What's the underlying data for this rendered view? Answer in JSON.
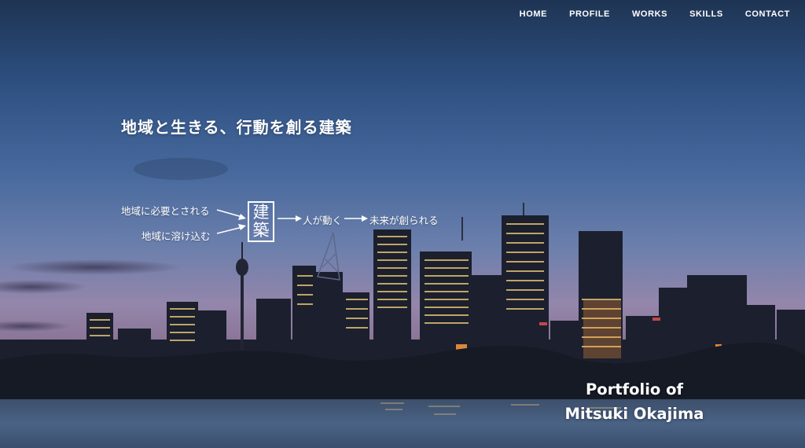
{
  "nav": {
    "items": [
      {
        "label": "HOME"
      },
      {
        "label": "PROFILE"
      },
      {
        "label": "WORKS"
      },
      {
        "label": "SKILLS"
      },
      {
        "label": "CONTACT"
      }
    ]
  },
  "hero": {
    "headline": "地域と生きる、行動を創る建築",
    "concept": {
      "input_top": "地域に必要とされる",
      "input_bottom": "地域に溶け込む",
      "center_chars": [
        "建",
        "築"
      ],
      "step_one": "人が動く",
      "step_two": "未来が創られる"
    },
    "portfolio_line1": "Portfolio of",
    "portfolio_line2": "Mitsuki Okajima"
  },
  "colors": {
    "sky_top": "#1e3453",
    "sky_horizon": "#9486ab",
    "water": "#232837",
    "text": "#ffffff"
  },
  "background_image": "night city skyline over water"
}
